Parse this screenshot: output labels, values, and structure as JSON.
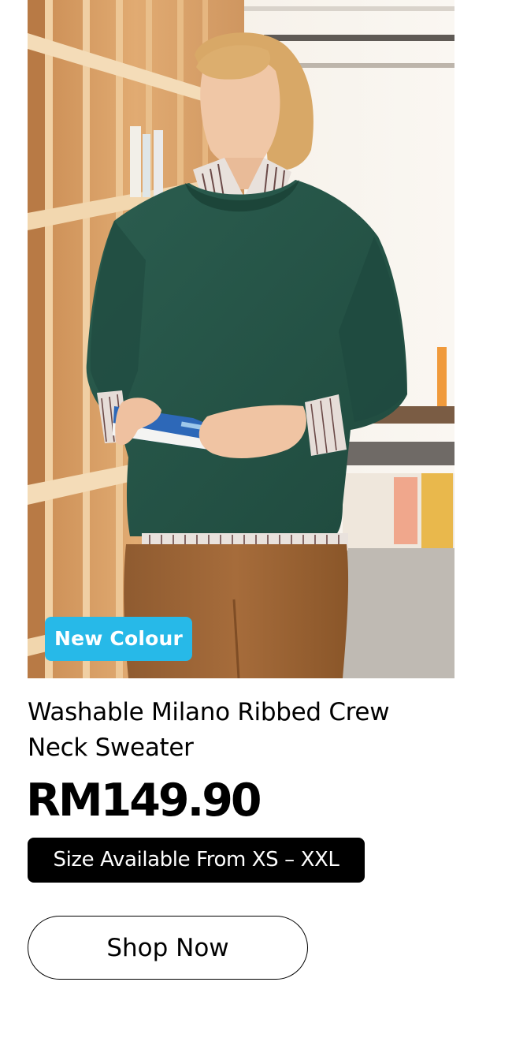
{
  "product": {
    "image_alt": "Model wearing green crew neck sweater holding books",
    "badge": "New Colour",
    "name": "Washable Milano Ribbed Crew Neck Sweater",
    "price": "RM149.90",
    "size_note": "Size Available From XS – XXL",
    "cta_label": "Shop Now"
  },
  "colors": {
    "badge_bg": "#27b9e8",
    "sweater": "#245245",
    "trousers": "#9a6436",
    "shelving": "#d49a62",
    "size_pill_bg": "#000000"
  }
}
